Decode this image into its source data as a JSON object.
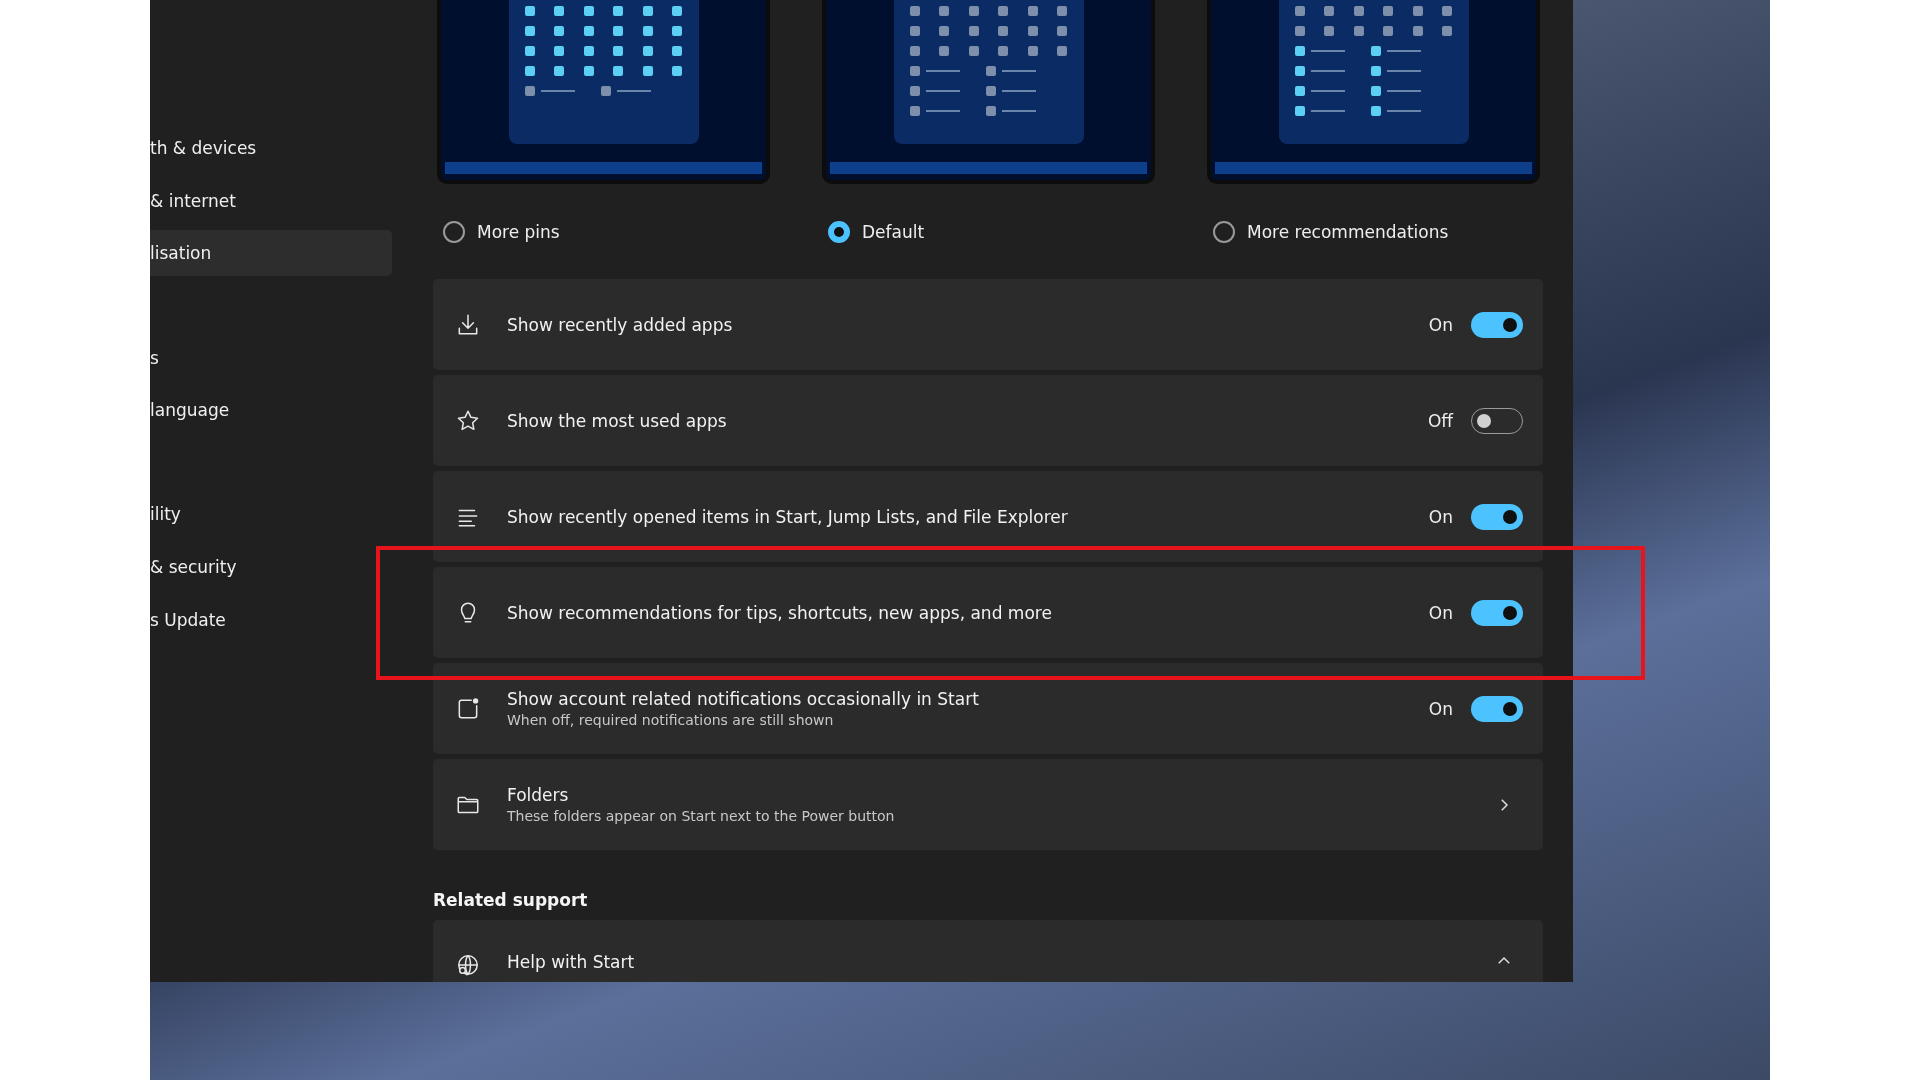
{
  "sidebar": {
    "items": [
      {
        "label": "th & devices",
        "selected": false
      },
      {
        "label": "& internet",
        "selected": false
      },
      {
        "label": "lisation",
        "selected": true
      },
      {
        "label": "s",
        "selected": false
      },
      {
        "label": "language",
        "selected": false
      },
      {
        "label": "ility",
        "selected": false
      },
      {
        "label": "& security",
        "selected": false
      },
      {
        "label": "s Update",
        "selected": false
      }
    ]
  },
  "layout_options": [
    {
      "label": "More pins",
      "selected": false
    },
    {
      "label": "Default",
      "selected": true
    },
    {
      "label": "More recommendations",
      "selected": false
    }
  ],
  "settings": [
    {
      "kind": "toggle",
      "title": "Show recently added apps",
      "state_label": "On",
      "on": true
    },
    {
      "kind": "toggle",
      "title": "Show the most used apps",
      "state_label": "Off",
      "on": false
    },
    {
      "kind": "toggle",
      "title": "Show recently opened items in Start, Jump Lists, and File Explorer",
      "state_label": "On",
      "on": true
    },
    {
      "kind": "toggle",
      "title": "Show recommendations for tips, shortcuts, new apps, and more",
      "state_label": "On",
      "on": true
    },
    {
      "kind": "toggle",
      "title": "Show account related notifications occasionally in Start",
      "subtitle": "When off, required notifications are still shown",
      "state_label": "On",
      "on": true
    },
    {
      "kind": "link",
      "title": "Folders",
      "subtitle": "These folders appear on Start next to the Power button"
    }
  ],
  "related_support": {
    "heading": "Related support",
    "items": [
      {
        "title": "Help with Start",
        "expanded": true
      }
    ]
  }
}
